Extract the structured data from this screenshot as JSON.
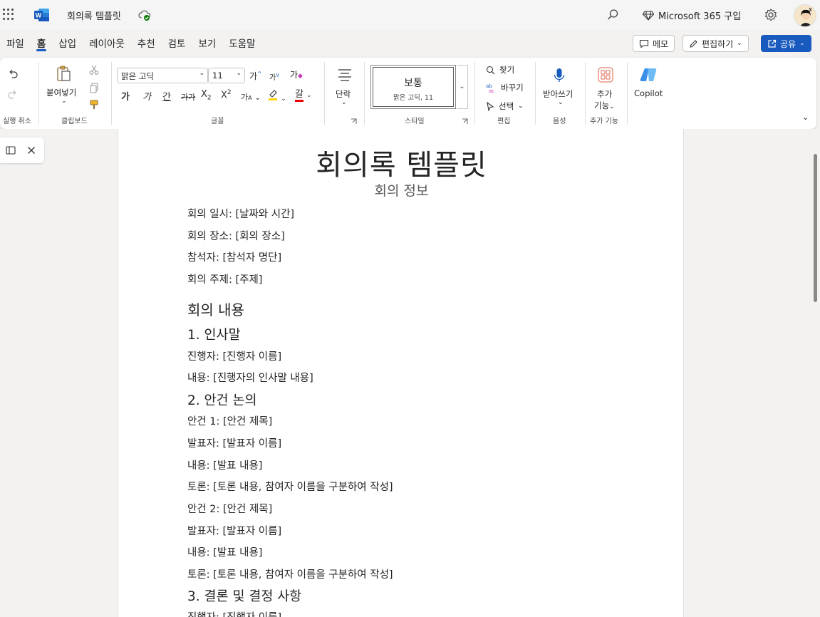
{
  "titlebar": {
    "doc_title": "회의록 템플릿",
    "m365": "Microsoft 365 구입"
  },
  "tabs": [
    "파일",
    "홈",
    "삽입",
    "레이아웃",
    "추천",
    "검토",
    "보기",
    "도움말"
  ],
  "top_buttons": {
    "memo": "메모",
    "edit": "편집하기",
    "share": "공유"
  },
  "ribbon": {
    "undo_label": "실행 취소",
    "paste_label": "붙여넣기",
    "clipboard_label": "클립보드",
    "font_name": "맑은 고딕",
    "font_size": "11",
    "font_label": "글꼴",
    "paragraph_btn": "단락",
    "style_name": "보통",
    "style_desc": "맑은 고딕, 11",
    "style_label": "스타일",
    "find": "찾기",
    "replace": "바꾸기",
    "select": "선택",
    "edit_label": "편집",
    "dictate": "받아쓰기",
    "voice_label": "음성",
    "addins_line1": "추가",
    "addins_line2": "기능",
    "addins_label": "추가 기능",
    "copilot": "Copilot"
  },
  "document": {
    "title": "회의록 템플릿",
    "subtitle": "회의 정보",
    "info": [
      "회의 일시: [날짜와 시간]",
      "회의 장소: [회의 장소]",
      "참석자: [참석자 명단]",
      "회의 주제: [주제]"
    ],
    "section_heading": "회의 내용",
    "s1_heading": "1. 인사말",
    "s1_lines": [
      "진행자: [진행자 이름]",
      "내용: [진행자의 인사말 내용]"
    ],
    "s2_heading": "2. 안건 논의",
    "s2_lines": [
      "안건 1: [안건 제목]",
      "발표자: [발표자 이름]",
      "내용: [발표 내용]",
      "토론: [토론 내용, 참여자 이름을 구분하여 작성]",
      "안건 2: [안건 제목]",
      "발표자: [발표자 이름]",
      "내용: [발표 내용]",
      "토론: [토론 내용, 참여자 이름을 구분하여 작성]"
    ],
    "s3_heading": "3. 결론 및 결정 사항",
    "s3_lines": [
      "진행자: [진행자 이름]"
    ]
  }
}
